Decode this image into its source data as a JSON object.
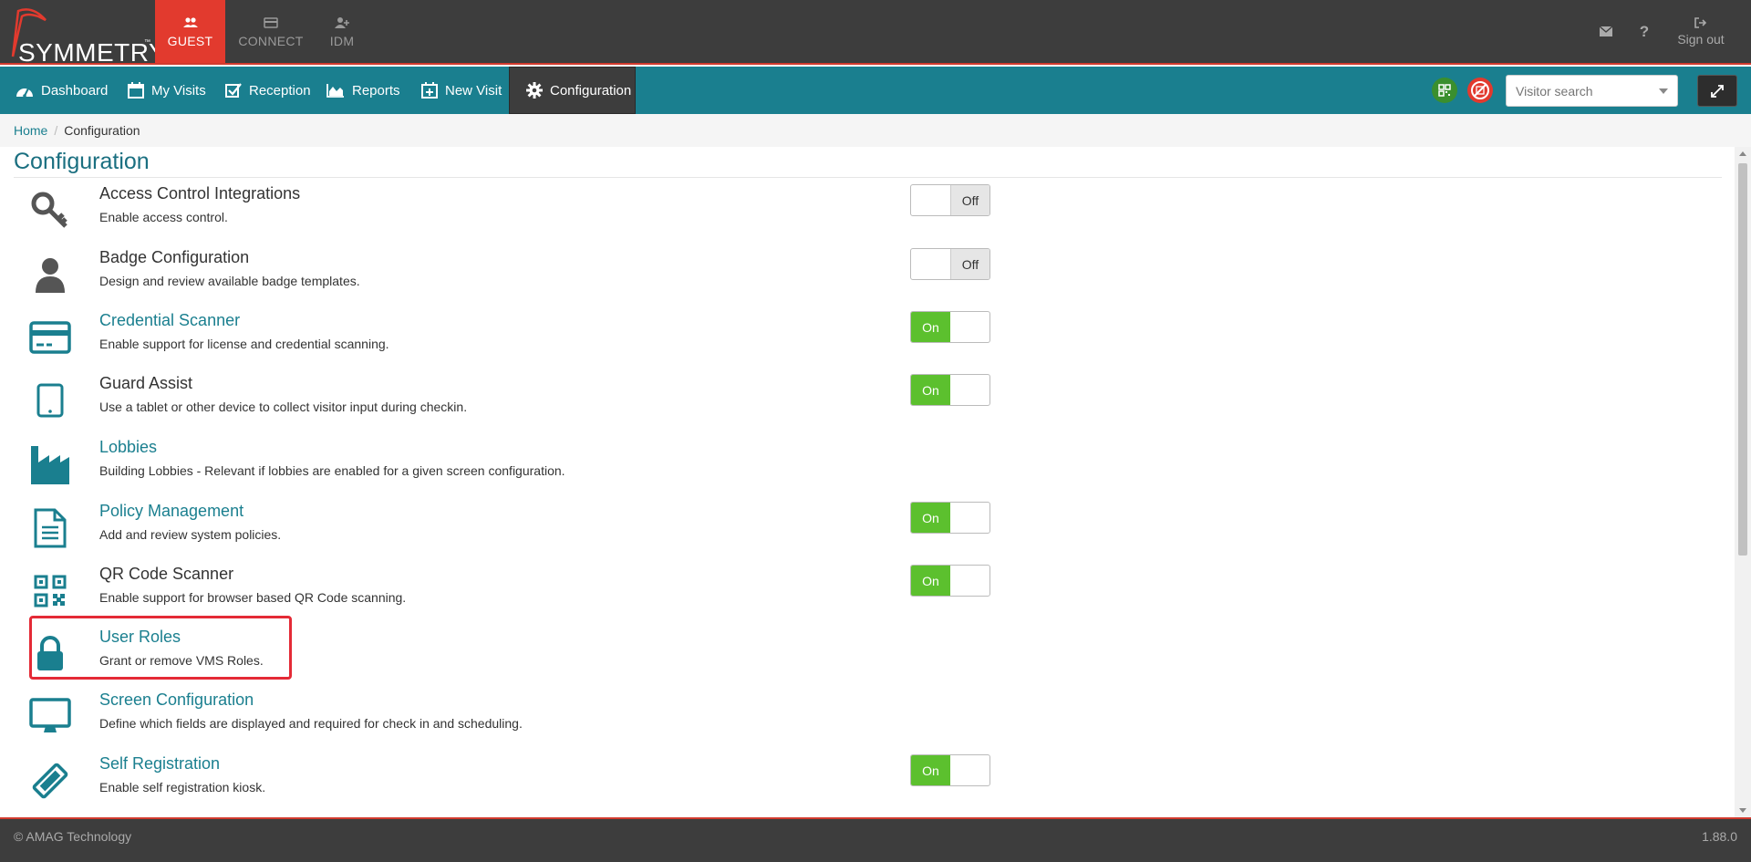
{
  "brand": {
    "logo_text": "SYMMETRY",
    "tm": "™"
  },
  "app_tabs": [
    {
      "label": "GUEST",
      "icon": "users-icon",
      "active": true
    },
    {
      "label": "CONNECT",
      "icon": "card-icon",
      "active": false
    },
    {
      "label": "IDM",
      "icon": "user-plus-icon",
      "active": false
    }
  ],
  "top_right": {
    "signout_label": "Sign out"
  },
  "nav": [
    {
      "label": "Dashboard",
      "icon": "dashboard-icon"
    },
    {
      "label": "My Visits",
      "icon": "calendar-icon"
    },
    {
      "label": "Reception",
      "icon": "check-square-icon"
    },
    {
      "label": "Reports",
      "icon": "area-chart-icon"
    },
    {
      "label": "New Visit",
      "icon": "calendar-plus-icon"
    },
    {
      "label": "Configuration",
      "icon": "gear-icon",
      "active": true
    }
  ],
  "search": {
    "placeholder": "Visitor search"
  },
  "breadcrumb": {
    "home": "Home",
    "separator": "/",
    "current": "Configuration"
  },
  "page": {
    "title": "Configuration"
  },
  "config_items": [
    {
      "name": "Access Control Integrations",
      "desc": "Enable access control.",
      "icon": "key-icon",
      "link": false,
      "toggle": "Off"
    },
    {
      "name": "Badge Configuration",
      "desc": "Design and review available badge templates.",
      "icon": "user-icon",
      "link": false,
      "toggle": "Off"
    },
    {
      "name": "Credential Scanner",
      "desc": "Enable support for license and credential scanning.",
      "icon": "credit-card-icon",
      "link": true,
      "toggle": "On"
    },
    {
      "name": "Guard Assist",
      "desc": "Use a tablet or other device to collect visitor input during checkin.",
      "icon": "tablet-icon",
      "link": false,
      "toggle": "On"
    },
    {
      "name": "Lobbies",
      "desc": "Building Lobbies - Relevant if lobbies are enabled for a given screen configuration.",
      "icon": "building-icon",
      "link": true,
      "toggle": null
    },
    {
      "name": "Policy Management",
      "desc": "Add and review system policies.",
      "icon": "document-icon",
      "link": true,
      "toggle": "On"
    },
    {
      "name": "QR Code Scanner",
      "desc": "Enable support for browser based QR Code scanning.",
      "icon": "qr-code-icon",
      "link": false,
      "toggle": "On"
    },
    {
      "name": "User Roles",
      "desc": "Grant or remove VMS Roles.",
      "icon": "lock-icon",
      "link": true,
      "toggle": null
    },
    {
      "name": "Screen Configuration",
      "desc": "Define which fields are displayed and required for check in and scheduling.",
      "icon": "monitor-icon",
      "link": true,
      "toggle": null
    },
    {
      "name": "Self Registration",
      "desc": "Enable self registration kiosk.",
      "icon": "ticket-icon",
      "link": true,
      "toggle": "On"
    }
  ],
  "footer": {
    "copyright": "© AMAG Technology",
    "version": "1.88.0"
  },
  "colors": {
    "teal": "#1a7f8f",
    "red": "#e23a2e",
    "green": "#5cc02e",
    "dark": "#3d3d3d"
  }
}
